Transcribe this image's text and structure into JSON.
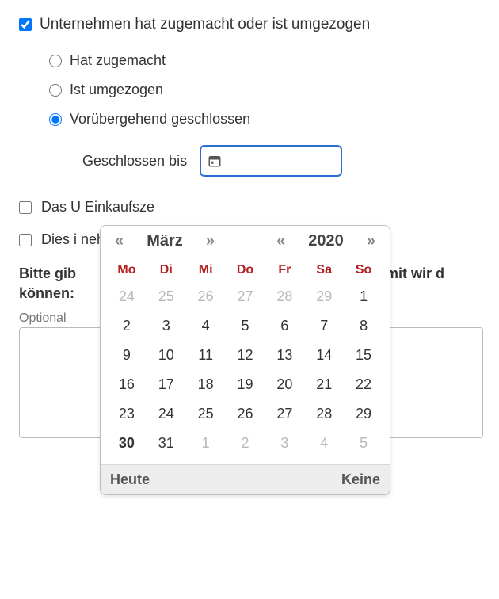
{
  "main_checkbox_label": "Unternehmen hat zugemacht oder ist umgezogen",
  "main_checkbox_checked": true,
  "radios": {
    "closed": {
      "label": "Hat zugemacht",
      "checked": false
    },
    "moved": {
      "label": "Ist umgezogen",
      "checked": false
    },
    "temp_closed": {
      "label": "Vorübergehend geschlossen",
      "checked": true
    }
  },
  "closed_until": {
    "label": "Geschlossen bis",
    "value": ""
  },
  "checkbox_mall": {
    "label": "Das U                                                                                       Einkaufsze",
    "checked": false
  },
  "checkbox_headquarter": {
    "label": "Dies i                                                                                          nehmens a",
    "checked": false
  },
  "prompt_line1": "Bitte gib",
  "prompt_line2_suffix": "damit wir d",
  "prompt_line3": "können:",
  "optional_label": "Optional",
  "textarea_value": "",
  "datepicker": {
    "month": "März",
    "year": "2020",
    "nav_prev": "«",
    "nav_next": "»",
    "dow": [
      "Mo",
      "Di",
      "Mi",
      "Do",
      "Fr",
      "Sa",
      "So"
    ],
    "weeks": [
      [
        {
          "d": "24",
          "other": true
        },
        {
          "d": "25",
          "other": true
        },
        {
          "d": "26",
          "other": true
        },
        {
          "d": "27",
          "other": true
        },
        {
          "d": "28",
          "other": true
        },
        {
          "d": "29",
          "other": true
        },
        {
          "d": "1"
        }
      ],
      [
        {
          "d": "2"
        },
        {
          "d": "3"
        },
        {
          "d": "4"
        },
        {
          "d": "5"
        },
        {
          "d": "6"
        },
        {
          "d": "7"
        },
        {
          "d": "8"
        }
      ],
      [
        {
          "d": "9"
        },
        {
          "d": "10"
        },
        {
          "d": "11"
        },
        {
          "d": "12"
        },
        {
          "d": "13"
        },
        {
          "d": "14"
        },
        {
          "d": "15"
        }
      ],
      [
        {
          "d": "16"
        },
        {
          "d": "17"
        },
        {
          "d": "18"
        },
        {
          "d": "19"
        },
        {
          "d": "20"
        },
        {
          "d": "21"
        },
        {
          "d": "22"
        }
      ],
      [
        {
          "d": "23"
        },
        {
          "d": "24"
        },
        {
          "d": "25"
        },
        {
          "d": "26"
        },
        {
          "d": "27"
        },
        {
          "d": "28"
        },
        {
          "d": "29"
        }
      ],
      [
        {
          "d": "30",
          "bold": true
        },
        {
          "d": "31"
        },
        {
          "d": "1",
          "other": true
        },
        {
          "d": "2",
          "other": true
        },
        {
          "d": "3",
          "other": true
        },
        {
          "d": "4",
          "other": true
        },
        {
          "d": "5",
          "other": true
        }
      ]
    ],
    "today_label": "Heute",
    "none_label": "Keine"
  }
}
